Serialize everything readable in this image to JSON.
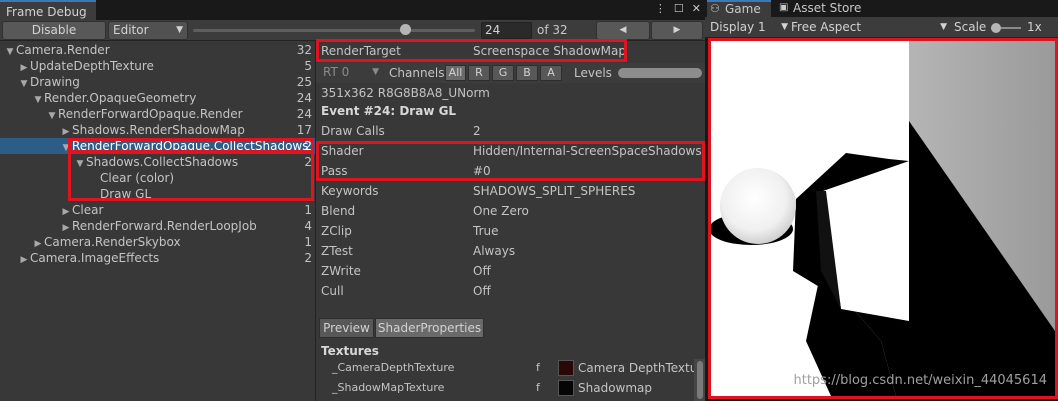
{
  "frame_debug": {
    "tab_title": "Frame Debug",
    "disable_label": "Disable",
    "target_dropdown": "Editor",
    "event_index": "24",
    "event_total": "of 32",
    "prev_label": "◀",
    "next_label": "▶",
    "slider_fraction": 0.75
  },
  "tree": [
    {
      "label": "Camera.Render",
      "count": "32",
      "arrow": "▼",
      "indent": 0
    },
    {
      "label": "UpdateDepthTexture",
      "count": "5",
      "arrow": "▶",
      "indent": 1
    },
    {
      "label": "Drawing",
      "count": "25",
      "arrow": "▼",
      "indent": 1
    },
    {
      "label": "Render.OpaqueGeometry",
      "count": "24",
      "arrow": "▼",
      "indent": 2
    },
    {
      "label": "RenderForwardOpaque.Render",
      "count": "24",
      "arrow": "▼",
      "indent": 3
    },
    {
      "label": "Shadows.RenderShadowMap",
      "count": "17",
      "arrow": "▶",
      "indent": 4
    },
    {
      "label": "RenderForwardOpaque.CollectShadows",
      "count": "2",
      "arrow": "▼",
      "indent": 4,
      "selected": true
    },
    {
      "label": "Shadows.CollectShadows",
      "count": "2",
      "arrow": "▼",
      "indent": 5
    },
    {
      "label": "Clear (color)",
      "count": "",
      "arrow": "",
      "indent": 6
    },
    {
      "label": "Draw GL",
      "count": "",
      "arrow": "",
      "indent": 6
    },
    {
      "label": "Clear",
      "count": "1",
      "arrow": "▶",
      "indent": 4
    },
    {
      "label": "RenderForward.RenderLoopJob",
      "count": "4",
      "arrow": "▶",
      "indent": 4
    },
    {
      "label": "Camera.RenderSkybox",
      "count": "1",
      "arrow": "▶",
      "indent": 2
    },
    {
      "label": "Camera.ImageEffects",
      "count": "2",
      "arrow": "▶",
      "indent": 1
    }
  ],
  "details": {
    "render_target_label": "RenderTarget",
    "render_target_value": "Screenspace ShadowMap",
    "rt_dropdown": "RT 0",
    "channels_label": "Channels",
    "channels": [
      "All",
      "R",
      "G",
      "B",
      "A"
    ],
    "levels_label": "Levels",
    "format": "351x362 R8G8B8A8_UNorm",
    "event_title": "Event #24: Draw GL",
    "props": [
      {
        "label": "Draw Calls",
        "value": "2"
      },
      {
        "label": "Shader",
        "value": "Hidden/Internal-ScreenSpaceShadows, S"
      },
      {
        "label": "Pass",
        "value": "#0"
      },
      {
        "label": "Keywords",
        "value": "SHADOWS_SPLIT_SPHERES"
      },
      {
        "label": "Blend",
        "value": "One Zero"
      },
      {
        "label": "ZClip",
        "value": "True"
      },
      {
        "label": "ZTest",
        "value": "Always"
      },
      {
        "label": "ZWrite",
        "value": "Off"
      },
      {
        "label": "Cull",
        "value": "Off"
      }
    ],
    "preview_tab": "Preview",
    "shader_props_tab": "ShaderProperties",
    "textures_label": "Textures",
    "textures": [
      {
        "name": "_CameraDepthTexture",
        "stage": "f",
        "value": "Camera DepthTextur",
        "color": "#2a0808"
      },
      {
        "name": "_ShadowMapTexture",
        "stage": "f",
        "value": "Shadowmap",
        "color": "#050505"
      }
    ]
  },
  "game": {
    "tab_game": "Game",
    "tab_store": "Asset Store",
    "display": "Display 1",
    "aspect": "Free Aspect",
    "scale_label": "Scale",
    "scale_value": "1x",
    "watermark": "https://blog.csdn.net/weixin_44045614"
  },
  "colors": {
    "highlight_red": "#e0141e",
    "selection_blue": "#2c5d87",
    "tab_accent": "#3a79bb"
  }
}
